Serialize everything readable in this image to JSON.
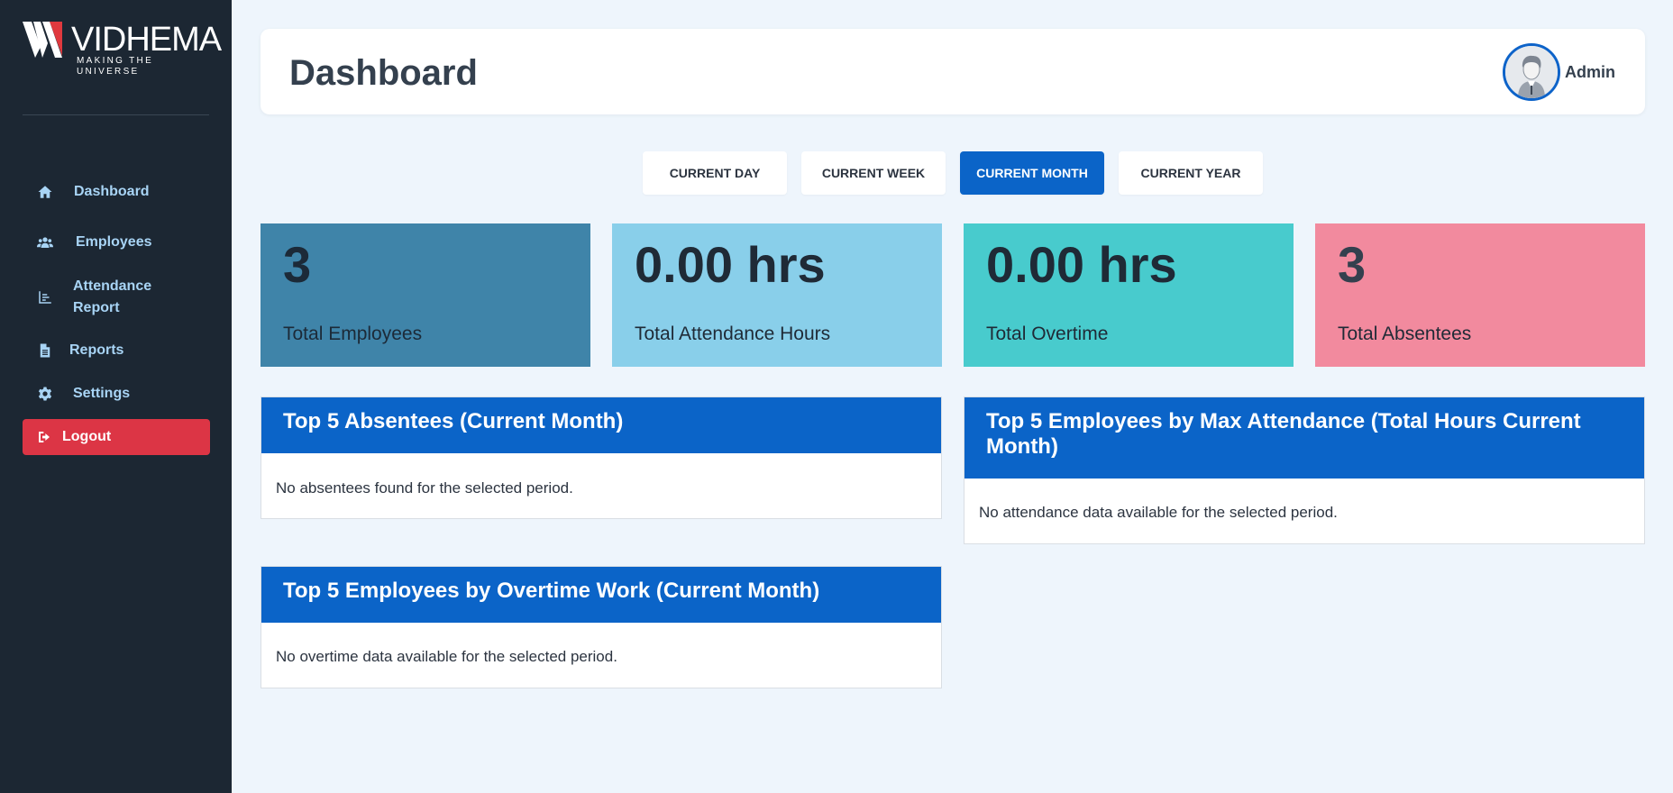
{
  "brand": {
    "name": "VIDHEMA",
    "tagline": "MAKING THE UNIVERSE"
  },
  "sidebar": {
    "items": [
      {
        "label": "Dashboard",
        "icon": "home-icon"
      },
      {
        "label": "Employees",
        "icon": "users-icon"
      },
      {
        "label": "Attendance Report",
        "icon": "chart-icon"
      },
      {
        "label": "Reports",
        "icon": "document-icon"
      },
      {
        "label": "Settings",
        "icon": "gear-icon"
      }
    ],
    "logout": {
      "label": "Logout",
      "icon": "sign-out-icon"
    }
  },
  "header": {
    "title": "Dashboard",
    "user": "Admin"
  },
  "periods": {
    "day": "CURRENT DAY",
    "week": "CURRENT WEEK",
    "month": "CURRENT MONTH",
    "year": "CURRENT YEAR",
    "active": "CURRENT MONTH"
  },
  "stats": [
    {
      "value": "3",
      "label": "Total Employees"
    },
    {
      "value": "0.00 hrs",
      "label": "Total Attendance Hours"
    },
    {
      "value": "0.00 hrs",
      "label": "Total Overtime"
    },
    {
      "value": "3",
      "label": "Total Absentees"
    }
  ],
  "panels": {
    "absentees": {
      "title": "Top 5 Absentees (Current Month)",
      "empty": "No absentees found for the selected period."
    },
    "max_attendance": {
      "title": "Top 5 Employees by Max Attendance (Total Hours Current Month)",
      "empty": "No attendance data available for the selected period."
    },
    "overtime": {
      "title": "Top 5 Employees by Overtime Work (Current Month)",
      "empty": "No overtime data available for the selected period."
    }
  },
  "colors": {
    "sidebar_bg": "#1c2733",
    "accent": "#0b64c8",
    "logout": "#dc3545",
    "card_employees": "#3f84a9",
    "card_attendance": "#89cfea",
    "card_overtime": "#48cbcd",
    "card_absentees": "#f28a9e"
  }
}
